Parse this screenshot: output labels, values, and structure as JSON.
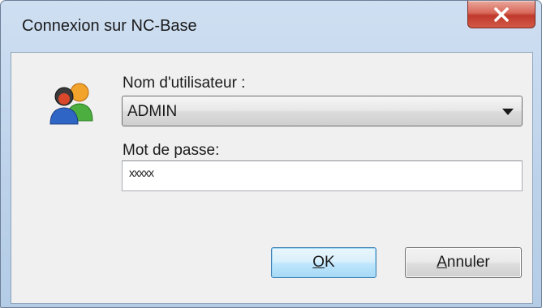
{
  "window": {
    "title": "Connexion sur NC-Base",
    "close_icon": "close-icon"
  },
  "form": {
    "icon": "users-icon",
    "username_label": "Nom d'utilisateur :",
    "username_value": "ADMIN",
    "password_label": "Mot de passe:",
    "password_value": "xxxxx"
  },
  "buttons": {
    "ok": {
      "mnemonic": "O",
      "rest": "K"
    },
    "cancel": {
      "mnemonic": "A",
      "rest": "nnuler"
    }
  },
  "colors": {
    "close_button": "#c0392b",
    "default_button_border": "#3c7fb1"
  }
}
